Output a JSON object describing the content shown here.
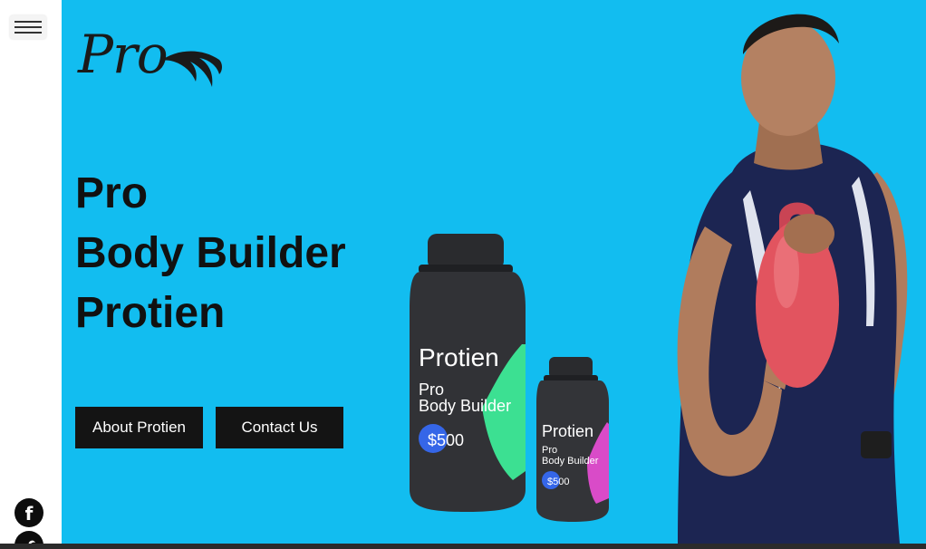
{
  "brand": {
    "logo_text": "Pro"
  },
  "nav": {
    "menu_icon": "hamburger-menu-icon"
  },
  "hero": {
    "headline_lines": [
      "Pro",
      "Body Builder",
      "Protien"
    ],
    "about_button_label": "About Protien",
    "contact_button_label": "Contact Us"
  },
  "products": {
    "large": {
      "title": "Protien",
      "line1": "Pro",
      "line2": "Body Builder",
      "price": "$500"
    },
    "small": {
      "title": "Protien",
      "line1": "Pro",
      "line2": "Body Builder",
      "price": "$500"
    }
  },
  "social": {
    "facebook_glyph": "f",
    "icons": [
      "facebook-icon",
      "twitter-icon"
    ]
  },
  "colors": {
    "hero_background": "#12bdf0",
    "button_background": "#141414",
    "text_dark": "#111111"
  }
}
